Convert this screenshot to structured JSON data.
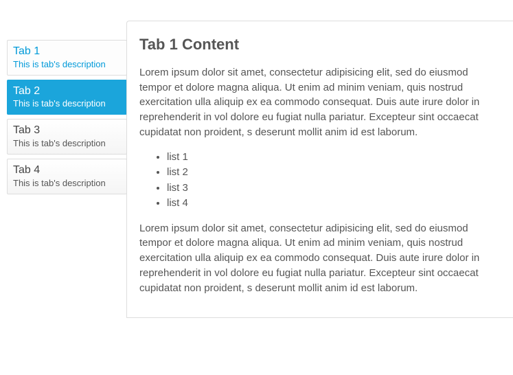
{
  "tabs": [
    {
      "title": "Tab 1",
      "desc": "This is tab's description",
      "state": "hovered"
    },
    {
      "title": "Tab 2",
      "desc": "This is tab's description",
      "state": "active"
    },
    {
      "title": "Tab 3",
      "desc": "This is tab's description",
      "state": ""
    },
    {
      "title": "Tab 4",
      "desc": "This is tab's description",
      "state": ""
    }
  ],
  "content": {
    "heading": "Tab 1 Content",
    "p1": "Lorem ipsum dolor sit amet, consectetur adipisicing elit, sed do eiusmod tempor et dolore magna aliqua. Ut enim ad minim veniam, quis nostrud exercitation ulla aliquip ex ea commodo consequat. Duis aute irure dolor in reprehenderit in vol dolore eu fugiat nulla pariatur. Excepteur sint occaecat cupidatat non proident, s deserunt mollit anim id est laborum.",
    "list": [
      "list 1",
      "list 2",
      "list 3",
      "list 4"
    ],
    "p2": "Lorem ipsum dolor sit amet, consectetur adipisicing elit, sed do eiusmod tempor et dolore magna aliqua. Ut enim ad minim veniam, quis nostrud exercitation ulla aliquip ex ea commodo consequat. Duis aute irure dolor in reprehenderit in vol dolore eu fugiat nulla pariatur. Excepteur sint occaecat cupidatat non proident, s deserunt mollit anim id est laborum."
  }
}
